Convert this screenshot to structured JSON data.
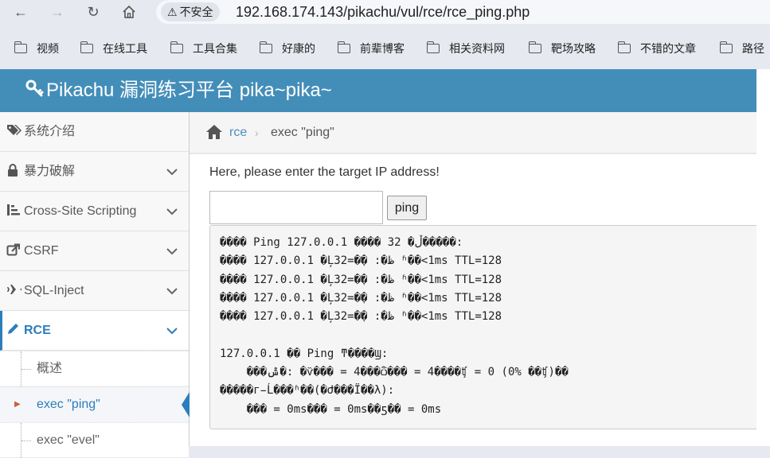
{
  "browser": {
    "security_label": "不安全",
    "url": "192.168.174.143/pikachu/vul/rce/rce_ping.php",
    "bookmarks": [
      "视频",
      "在线工具",
      "工具合集",
      "好康的",
      "前辈博客",
      "相关资料网",
      "靶场攻略",
      "不错的文章",
      "路径"
    ]
  },
  "app": {
    "title": "Pikachu 漏洞练习平台 pika~pika~"
  },
  "sidebar": {
    "items": [
      {
        "label": "系统介绍",
        "icon": "tags-icon"
      },
      {
        "label": "暴力破解",
        "icon": "lock-icon"
      },
      {
        "label": "Cross-Site Scripting",
        "icon": "sitemap-icon"
      },
      {
        "label": "CSRF",
        "icon": "share-icon"
      },
      {
        "label": "SQL-Inject",
        "icon": "plane-icon"
      },
      {
        "label": "RCE",
        "icon": "pencil-icon"
      }
    ],
    "subitems": [
      "概述",
      "exec \"ping\"",
      "exec \"evel\""
    ]
  },
  "breadcrumb": {
    "parent": "rce",
    "current": "exec \"ping\""
  },
  "main": {
    "prompt": "Here, please enter the target IP address!",
    "ip_value": "",
    "button_label": "ping",
    "output_lines": [
      "���� Ping 127.0.0.1 ���� 32 �ֽڵ�����:",
      "���� 127.0.0.1 �Ļظ�: �ֽ�=32 ʱ��<1ms TTL=128",
      "���� 127.0.0.1 �Ļظ�: �ֽ�=32 ʱ��<1ms TTL=128",
      "���� 127.0.0.1 �Ļظ�: �ֽ�=32 ʱ��<1ms TTL=128",
      "���� 127.0.0.1 �Ļظ�: �ֽ�=32 ʱ��<1ms TTL=128",
      "",
      "127.0.0.1 �� Ping ͳ����Ϣ:",
      "    ���ݰ�: �ѷ��� = 4���ѽ��� = 4����ʧ = 0 (0% ��ʧ)��",
      "�����г̵Ĺ���ʱ��(�Ժ���Ϊ��λ):",
      "    ��� = 0ms��� = 0ms��ƽ�� = 0ms"
    ]
  }
}
